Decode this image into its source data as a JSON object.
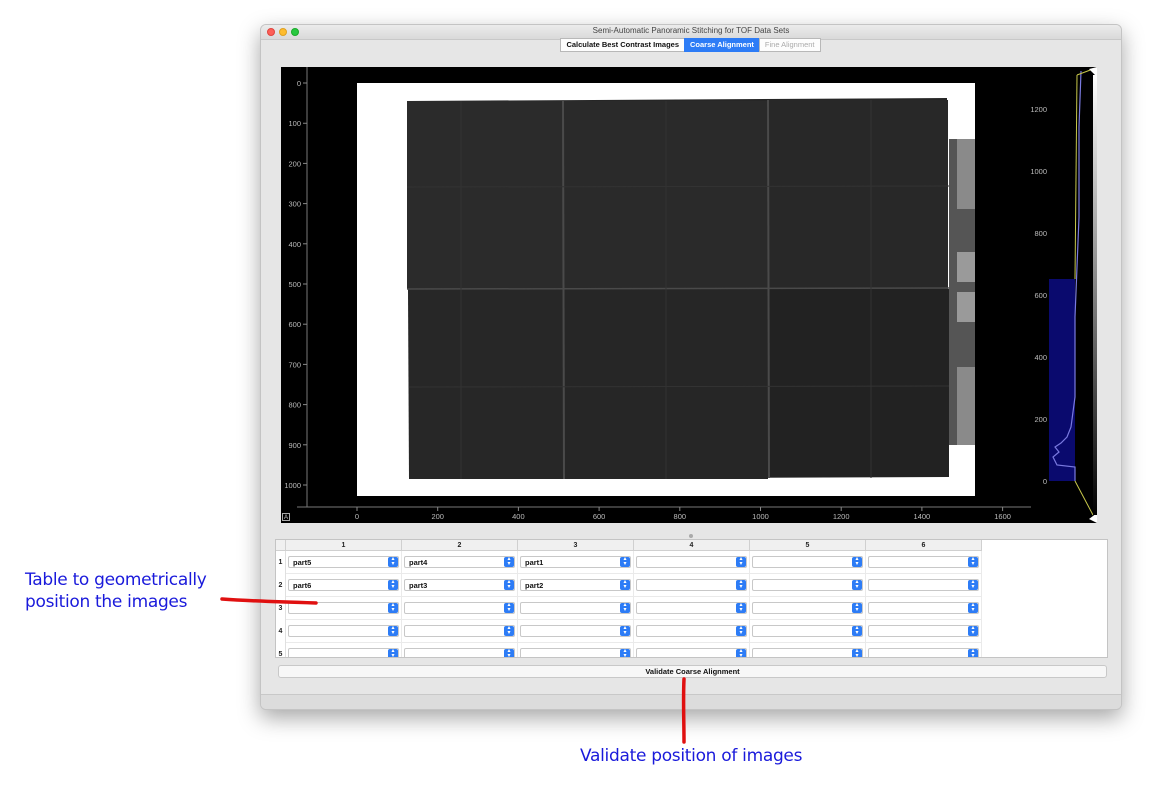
{
  "window": {
    "title": "Semi-Automatic Panoramic Stitching for TOF Data Sets",
    "tabs": [
      {
        "label": "Calculate Best Contrast Images",
        "state": "normal"
      },
      {
        "label": "Coarse Alignment",
        "state": "active"
      },
      {
        "label": "Fine Alignment",
        "state": "disabled"
      }
    ]
  },
  "viewer": {
    "y_ticks": [
      "0",
      "100",
      "200",
      "300",
      "400",
      "500",
      "600",
      "700",
      "800",
      "900",
      "1000"
    ],
    "x_ticks": [
      "0",
      "200",
      "400",
      "600",
      "800",
      "1000",
      "1200",
      "1400",
      "1600"
    ],
    "histogram_ticks": [
      "1200",
      "1000",
      "800",
      "600",
      "400",
      "200",
      "0"
    ],
    "corner_button": "A"
  },
  "table": {
    "columns": [
      "1",
      "2",
      "3",
      "4",
      "5",
      "6"
    ],
    "rows": [
      {
        "label": "1",
        "cells": [
          "part5",
          "part4",
          "part1",
          "",
          "",
          ""
        ]
      },
      {
        "label": "2",
        "cells": [
          "part6",
          "part3",
          "part2",
          "",
          "",
          ""
        ]
      },
      {
        "label": "3",
        "cells": [
          "",
          "",
          "",
          "",
          "",
          ""
        ]
      },
      {
        "label": "4",
        "cells": [
          "",
          "",
          "",
          "",
          "",
          ""
        ]
      },
      {
        "label": "5",
        "cells": [
          "",
          "",
          "",
          "",
          "",
          ""
        ]
      }
    ]
  },
  "validate_button": "Validate Coarse Alignment",
  "annotations": {
    "table_note": [
      "Table to geometrically",
      "position the images"
    ],
    "validate_note": "Validate position of images",
    "text_color": "#1a1adb",
    "arrow_color": "#e01010"
  },
  "colors": {
    "accent": "#2d7cf6",
    "histogram_fill": "#0a0a6e",
    "histogram_line": "#7a7ae0",
    "roi_line": "#c8c84a"
  }
}
